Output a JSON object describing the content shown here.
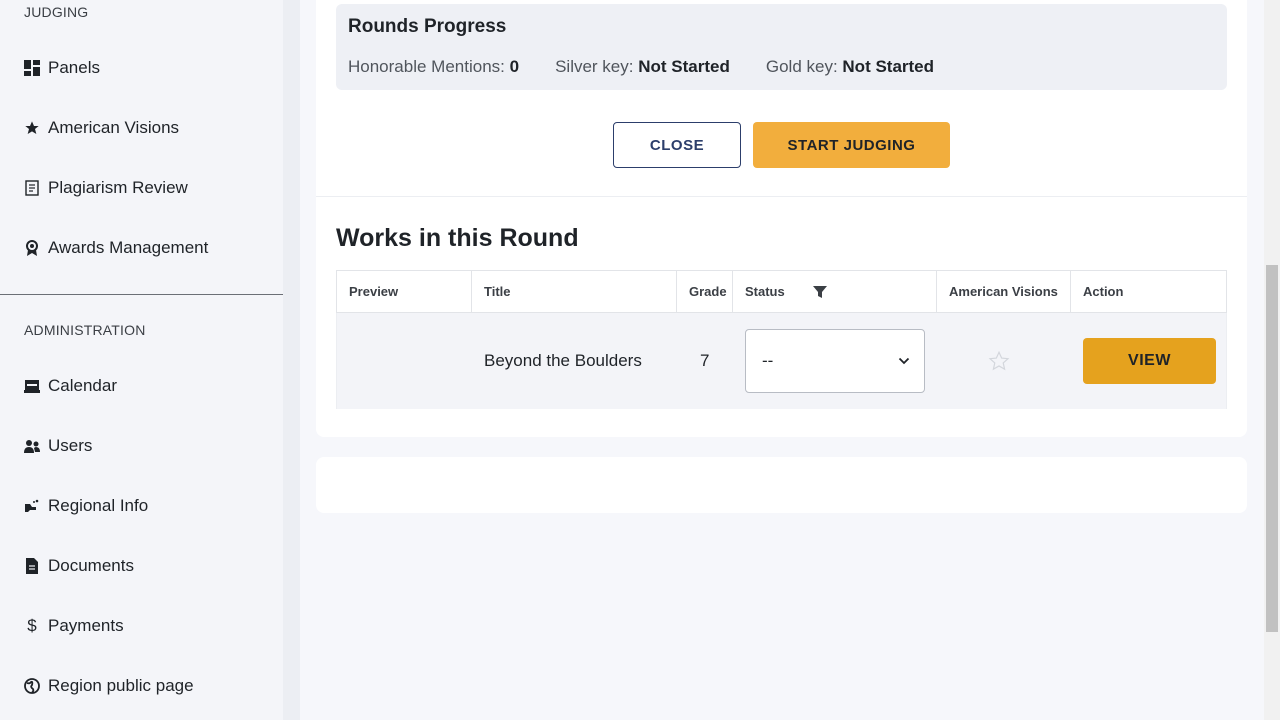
{
  "sidebar": {
    "judging_heading": "JUDGING",
    "judging_items": [
      {
        "label": "Panels",
        "icon": "dashboard-icon"
      },
      {
        "label": "American Visions",
        "icon": "star-icon"
      },
      {
        "label": "Plagiarism Review",
        "icon": "document-check-icon"
      },
      {
        "label": "Awards Management",
        "icon": "award-icon"
      }
    ],
    "admin_heading": "ADMINISTRATION",
    "admin_items": [
      {
        "label": "Calendar",
        "icon": "calendar-icon"
      },
      {
        "label": "Users",
        "icon": "users-icon"
      },
      {
        "label": "Regional Info",
        "icon": "regional-info-icon"
      },
      {
        "label": "Documents",
        "icon": "document-icon"
      },
      {
        "label": "Payments",
        "icon": "dollar-icon"
      },
      {
        "label": "Region public page",
        "icon": "globe-icon"
      }
    ]
  },
  "progress": {
    "title": "Rounds Progress",
    "honorable_label": "Honorable Mentions:",
    "honorable_value": "0",
    "silver_label": "Silver key:",
    "silver_value": "Not Started",
    "gold_label": "Gold key:",
    "gold_value": "Not Started"
  },
  "actions": {
    "close_label": "CLOSE",
    "start_label": "START JUDGING"
  },
  "works": {
    "title": "Works in this Round",
    "columns": [
      "Preview",
      "Title",
      "Grade",
      "Status",
      "American Visions",
      "Action"
    ],
    "rows": [
      {
        "preview": "",
        "title": "Beyond the Boulders",
        "grade": "7",
        "status": "--",
        "american_visions_starred": false,
        "action_label": "VIEW"
      }
    ]
  },
  "colors": {
    "accent_orange": "#f2ae3d",
    "view_orange": "#e5a21e",
    "close_border": "#2c3e6b"
  }
}
